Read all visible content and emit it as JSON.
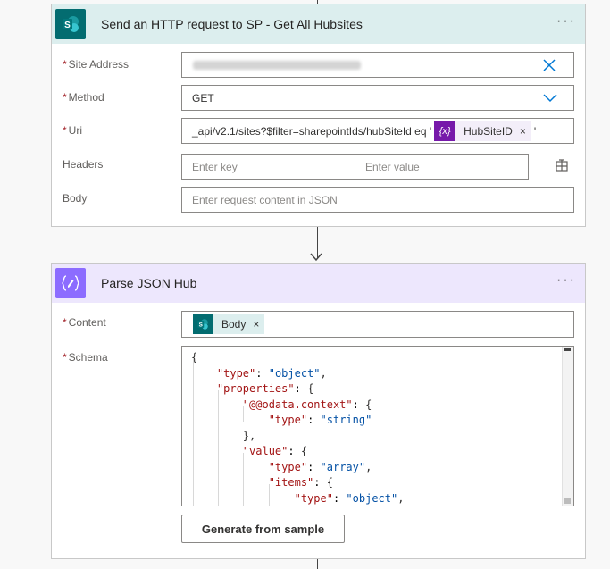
{
  "action1": {
    "title": "Send an HTTP request to SP - Get All Hubsites",
    "icon": "sharepoint-icon",
    "more": "···",
    "fields": {
      "site_label": "Site Address",
      "method_label": "Method",
      "method_value": "GET",
      "uri_label": "Uri",
      "uri_value": "_api/v2.1/sites?$filter=sharepointIds/hubSiteId eq '",
      "uri_token": "HubSiteID",
      "uri_suffix": "'",
      "headers_label": "Headers",
      "key_placeholder": "Enter key",
      "value_placeholder": "Enter value",
      "body_label": "Body",
      "body_placeholder": "Enter request content in JSON"
    }
  },
  "action2": {
    "title": "Parse JSON Hub",
    "icon": "parse-json-icon",
    "more": "···",
    "content_label": "Content",
    "content_token": "Body",
    "schema_label": "Schema",
    "schema_lines": [
      "{",
      "    \"type\": \"object\",",
      "    \"properties\": {",
      "        \"@@odata.context\": {",
      "            \"type\": \"string\"",
      "        },",
      "        \"value\": {",
      "            \"type\": \"array\",",
      "            \"items\": {",
      "                \"type\": \"object\","
    ],
    "generate_label": "Generate from sample"
  },
  "token_close": "×",
  "colors": {
    "sharepoint": "#036c70",
    "parse_json": "#8c6cff",
    "header1_bg": "#dceeee",
    "header2_bg": "#ede7fd",
    "expr_token": "#7719aa"
  }
}
